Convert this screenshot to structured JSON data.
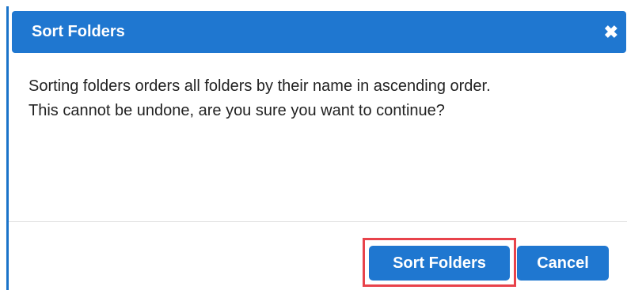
{
  "dialog": {
    "title": "Sort Folders",
    "close_symbol": "✖",
    "message_line1": "Sorting folders orders all folders by their name in ascending order.",
    "message_line2": "This cannot be undone, are you sure you want to continue?"
  },
  "buttons": {
    "confirm_label": "Sort Folders",
    "cancel_label": "Cancel"
  },
  "colors": {
    "primary": "#1f77d0",
    "highlight": "#e8434b",
    "text": "#222222"
  },
  "icons": {
    "close": "close-icon"
  }
}
